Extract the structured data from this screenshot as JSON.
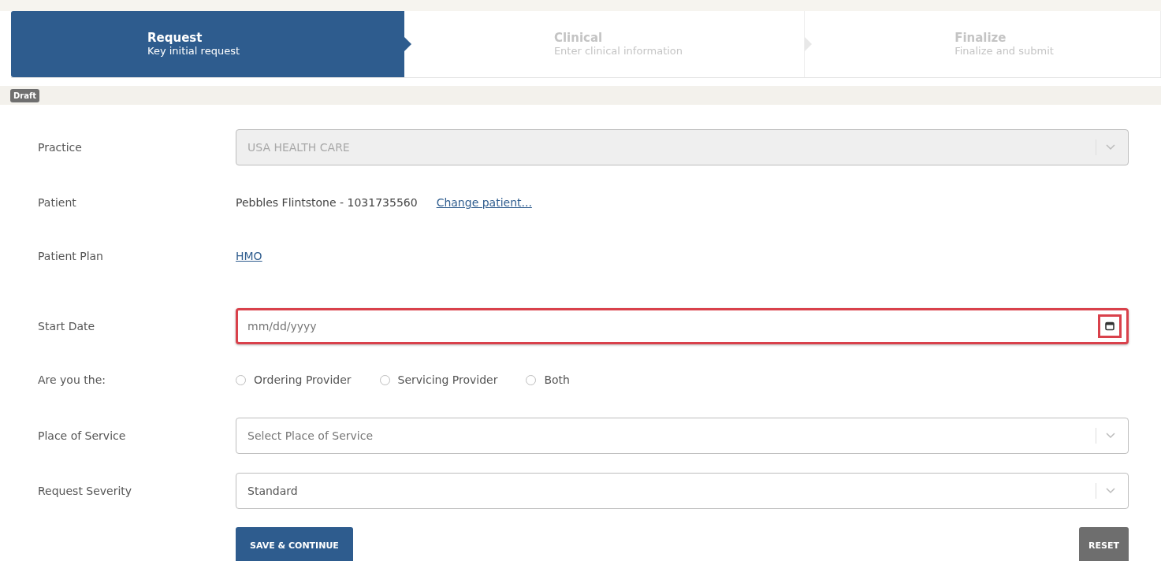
{
  "steps": [
    {
      "title": "Request",
      "subtitle": "Key initial request",
      "selected": true
    },
    {
      "title": "Clinical",
      "subtitle": "Enter clinical information",
      "selected": false
    },
    {
      "title": "Finalize",
      "subtitle": "Finalize and submit",
      "selected": false
    }
  ],
  "status_badge": "Draft",
  "fields": [
    {
      "kind": "select",
      "label": "Practice",
      "value": "USA HEALTH CARE",
      "disabled": true
    },
    {
      "kind": "patient",
      "label": "Patient",
      "value": "Pebbles Flintstone - 1031735560",
      "link": "Change patient..."
    },
    {
      "kind": "link",
      "label": "Patient Plan",
      "link": "HMO"
    },
    {
      "kind": "date",
      "label": "Start Date",
      "placeholder": "mm/dd/yyyy",
      "highlighted": true
    },
    {
      "kind": "radio",
      "label": "Are you the:",
      "options": [
        {
          "label": "Ordering Provider",
          "selected": false
        },
        {
          "label": "Servicing Provider",
          "selected": false
        },
        {
          "label": "Both",
          "selected": false
        }
      ]
    },
    {
      "kind": "select",
      "label": "Place of Service",
      "placeholder": "Select Place of Service",
      "disabled": false
    },
    {
      "kind": "select",
      "label": "Request Severity",
      "value": "Standard",
      "disabled": false
    }
  ],
  "buttons": {
    "primary": "SAVE & CONTINUE",
    "secondary": "RESET"
  }
}
